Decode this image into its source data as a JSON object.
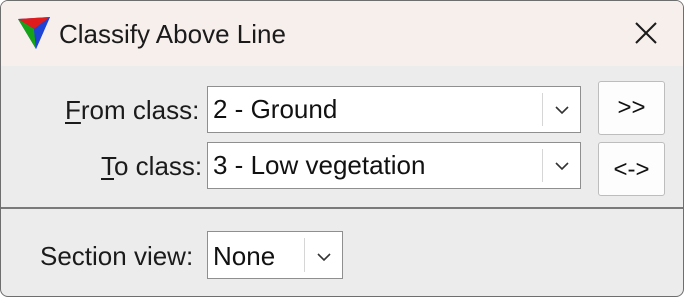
{
  "window": {
    "title": "Classify Above Line",
    "icons": {
      "app": "tri-color-cone-icon",
      "close": "close-icon"
    }
  },
  "form": {
    "from_class": {
      "label_mnemonic": "F",
      "label_rest": "rom class:",
      "value": "2 - Ground"
    },
    "to_class": {
      "label_mnemonic": "T",
      "label_rest": "o class:",
      "value": "3 - Low vegetation"
    },
    "buttons": {
      "forward": ">>",
      "swap": "<->"
    },
    "section_view": {
      "label": "Section view:",
      "value": "None"
    }
  },
  "colors": {
    "titlebar": "#f6efec",
    "body": "#ececec",
    "border": "#6e6e6e"
  }
}
